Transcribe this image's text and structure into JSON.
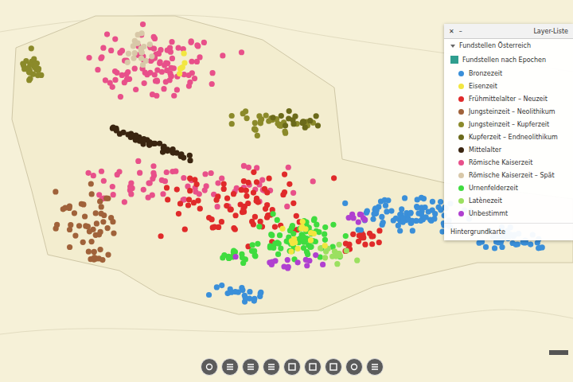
{
  "layer_list": {
    "title": "Layer-Liste",
    "close": "✕",
    "minimize": "–",
    "group": {
      "label": "Fundstellen Österreich",
      "expanded": true
    },
    "subgroup": {
      "label": "Fundstellen nach Epochen",
      "checked": true
    },
    "items": [
      {
        "label": "Bronzezeit",
        "color": "#3a8fd9",
        "checked": true
      },
      {
        "label": "Eisenzeit",
        "color": "#f2e640",
        "checked": true
      },
      {
        "label": "Frühmittelalter – Neuzeit",
        "color": "#e02a2a",
        "checked": true
      },
      {
        "label": "Jungsteinzeit – Neolithikum",
        "color": "#a0623a",
        "checked": true
      },
      {
        "label": "Jungsteinzeit – Kupferzeit",
        "color": "#8b8a2a",
        "checked": true
      },
      {
        "label": "Kupferzeit – Endneolithikum",
        "color": "#6b6a1a",
        "checked": true
      },
      {
        "label": "Mittelalter",
        "color": "#3a2510",
        "checked": true
      },
      {
        "label": "Römische Kaiserzeit",
        "color": "#e8508a",
        "checked": true
      },
      {
        "label": "Römische Kaiserzeit – Spät",
        "color": "#d8c8a8",
        "checked": true
      },
      {
        "label": "Urnenfelderzeit",
        "color": "#3fdc3f",
        "checked": true
      },
      {
        "label": "Latènezeit",
        "color": "#9be060",
        "checked": true
      },
      {
        "label": "Unbestimmt",
        "color": "#b040d0",
        "checked": true
      }
    ],
    "footer": "Hintergrundkarte"
  }
}
